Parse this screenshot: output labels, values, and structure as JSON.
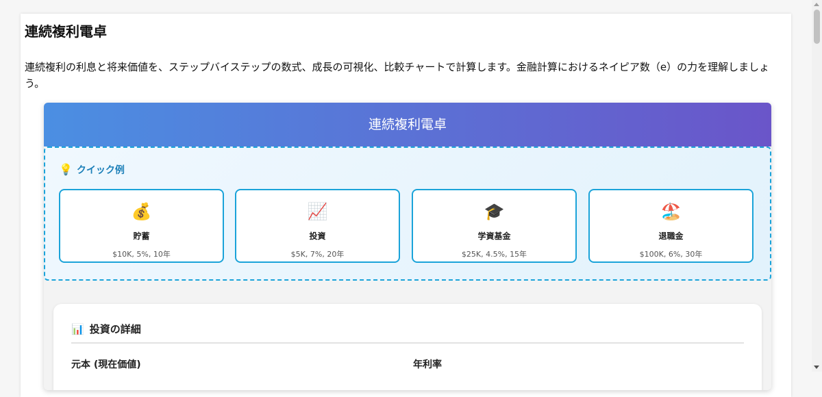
{
  "page": {
    "title": "連続複利電卓",
    "description": "連続複利の利息と将来価値を、ステップバイステップの数式、成長の可視化、比較チャートで計算します。金融計算におけるネイピア数（e）の力を理解しましょう。"
  },
  "calculator": {
    "header": "連続複利電卓",
    "quick_examples": {
      "title": "クイック例",
      "icon": "lightbulb-icon",
      "items": [
        {
          "icon": "money-bag-icon",
          "emoji": "💰",
          "name": "貯蓄",
          "detail": "$10K, 5%, 10年"
        },
        {
          "icon": "chart-increasing-icon",
          "emoji": "📈",
          "name": "投資",
          "detail": "$5K, 7%, 20年"
        },
        {
          "icon": "graduation-cap-icon",
          "emoji": "🎓",
          "name": "学資基金",
          "detail": "$25K, 4.5%, 15年"
        },
        {
          "icon": "beach-umbrella-icon",
          "emoji": "🏖️",
          "name": "退職金",
          "detail": "$100K, 6%, 30年"
        }
      ]
    },
    "investment_details": {
      "title": "投資の詳細",
      "icon": "bar-chart-icon",
      "principal_label": "元本 (現在価値)",
      "rate_label": "年利率"
    }
  },
  "colors": {
    "header_gradient_start": "#4b8fe2",
    "header_gradient_end": "#6a55c9",
    "accent": "#1aa3d9",
    "quick_title": "#1b7fb8"
  }
}
